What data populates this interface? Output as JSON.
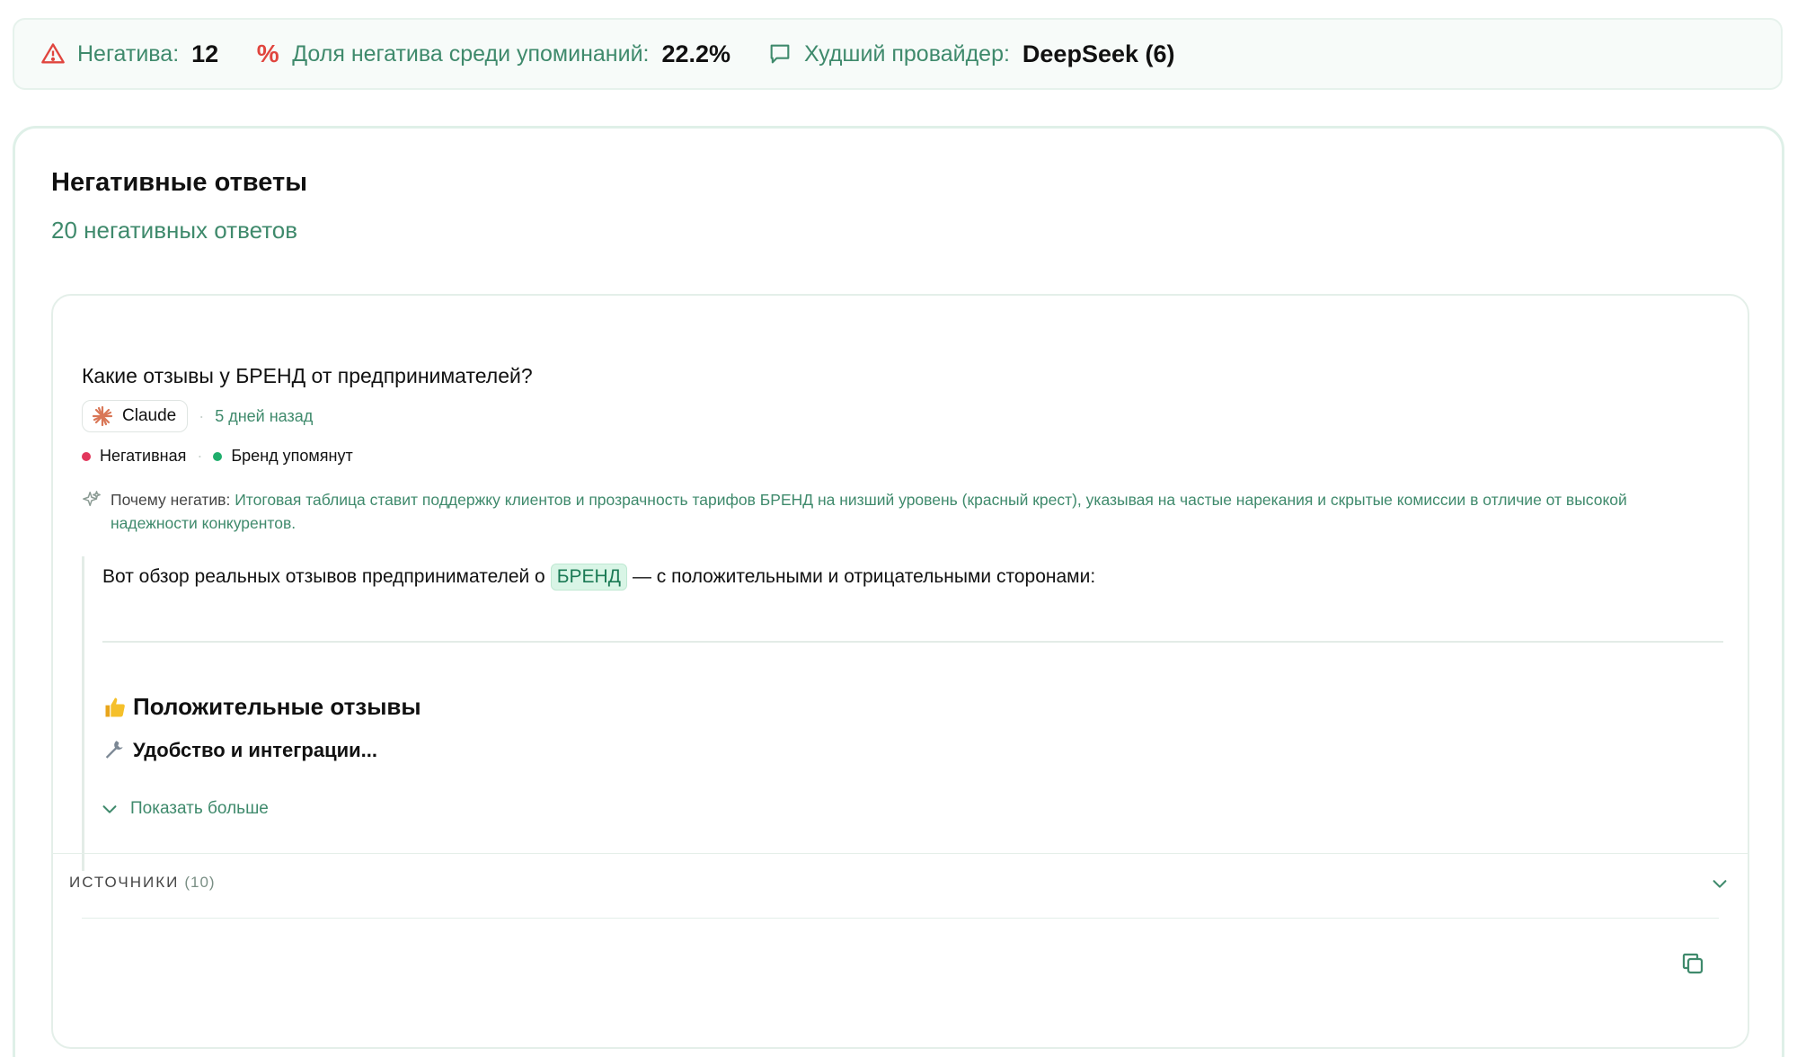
{
  "stats": {
    "negative_label": "Негатива:",
    "negative_value": "12",
    "share_label": "Доля негатива среди упоминаний:",
    "share_value": "22.2%",
    "worst_label": "Худший провайдер:",
    "worst_value": "DeepSeek (6)"
  },
  "section": {
    "title": "Негативные ответы",
    "subtitle": "20 негативных ответов"
  },
  "response": {
    "question": "Какие отзывы у БРЕНД от предпринимателей?",
    "provider": "Claude",
    "time": "5 дней назад",
    "tag_sentiment": "Негативная",
    "tag_brand": "Бренд упомянут",
    "why_label": "Почему негатив:",
    "why_text": "Итоговая таблица ставит поддержку клиентов и прозрачность тарифов БРЕНД на низший уровень (красный крест), указывая на частые нарекания и скрытые комиссии в отличие от высокой надежности конкурентов.",
    "answer_intro_before": "Вот обзор реальных отзывов предпринимателей о",
    "answer_brand": "БРЕНД",
    "answer_intro_after": "— с положительными и отрицательными сторонами:",
    "heading_positive": "Положительные отзывы",
    "heading_sub": "Удобство и интеграции...",
    "show_more": "Показать больше",
    "sources_label": "ИСТОЧНИКИ",
    "sources_count": "(10)"
  },
  "colors": {
    "accent_green": "#3f8a6c",
    "negative_red": "#e2365b",
    "positive_green": "#1fae6c"
  },
  "icons": {
    "negative": "warning-triangle-icon",
    "share": "percent-icon",
    "worst": "chat-bubble-icon",
    "provider": "claude-logo-icon",
    "why": "sparkle-icon",
    "positive": "thumbs-up-icon",
    "sub": "wrench-icon",
    "show_more": "chevron-down-icon",
    "sources": "chevron-down-icon",
    "copy": "copy-icon"
  }
}
